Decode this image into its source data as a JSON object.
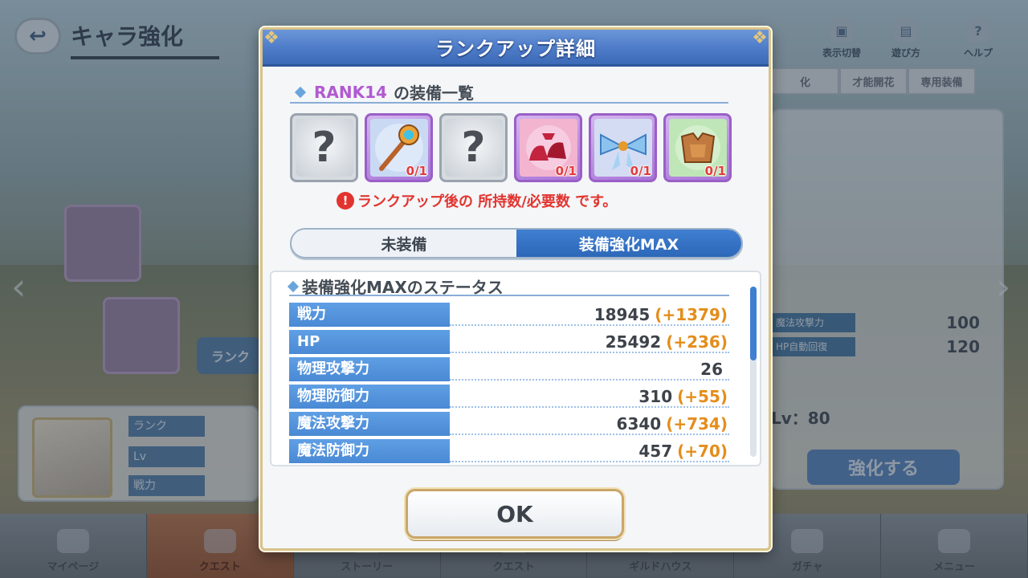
{
  "background": {
    "screen_title": "キャラ強化",
    "top_buttons": [
      "表示切替",
      "遊び方",
      "ヘルプ"
    ],
    "tabs": [
      "化",
      "才能開花",
      "専用装備"
    ],
    "stats": [
      {
        "label": "魔法攻撃力",
        "value": "100"
      },
      {
        "label": "HP自動回復",
        "value": "120"
      }
    ],
    "lv_text": "Lv：80",
    "enhance_label": "強化する",
    "rank_button": "ランク",
    "left_labels": [
      "ランク",
      "Lv",
      "戦力"
    ],
    "nav": [
      "マイページ",
      "クエスト",
      "ストーリー",
      "クエスト",
      "ギルドハウス",
      "ガチャ",
      "メニュー"
    ]
  },
  "modal": {
    "title": "ランクアップ詳細",
    "equipment_section": {
      "rank": "RANK14",
      "title_suffix": "の装備一覧",
      "slots": [
        {
          "type": "unknown",
          "icon": "question-mark",
          "count": ""
        },
        {
          "type": "owned",
          "icon": "staff",
          "count": "0/1"
        },
        {
          "type": "unknown",
          "icon": "question-mark",
          "count": ""
        },
        {
          "type": "owned",
          "icon": "red-shoes",
          "count": "0/1"
        },
        {
          "type": "owned",
          "icon": "blue-ribbon",
          "count": "0/1"
        },
        {
          "type": "owned",
          "icon": "bronze-armor",
          "count": "0/1"
        }
      ],
      "note": "ランクアップ後の 所持数/必要数 です。"
    },
    "toggle": {
      "options": [
        "未装備",
        "装備強化MAX"
      ],
      "selected": "装備強化MAX"
    },
    "status_section": {
      "title": "装備強化MAXのステータス",
      "rows": [
        {
          "label": "戦力",
          "value": "18945",
          "bonus": "(+1379)"
        },
        {
          "label": "HP",
          "value": "25492",
          "bonus": "(+236)"
        },
        {
          "label": "物理攻撃力",
          "value": "26",
          "bonus": ""
        },
        {
          "label": "物理防御力",
          "value": "310",
          "bonus": "(+55)"
        },
        {
          "label": "魔法攻撃力",
          "value": "6340",
          "bonus": "(+734)"
        },
        {
          "label": "魔法防御力",
          "value": "457",
          "bonus": "(+70)"
        }
      ]
    },
    "ok_label": "OK"
  },
  "colors": {
    "header_blue": "#4d7bc8",
    "stat_label_blue": "#4a89d4",
    "bonus_orange": "#e48d1b",
    "warning_red": "#e2342f",
    "rank_purple": "#b15ad0"
  }
}
